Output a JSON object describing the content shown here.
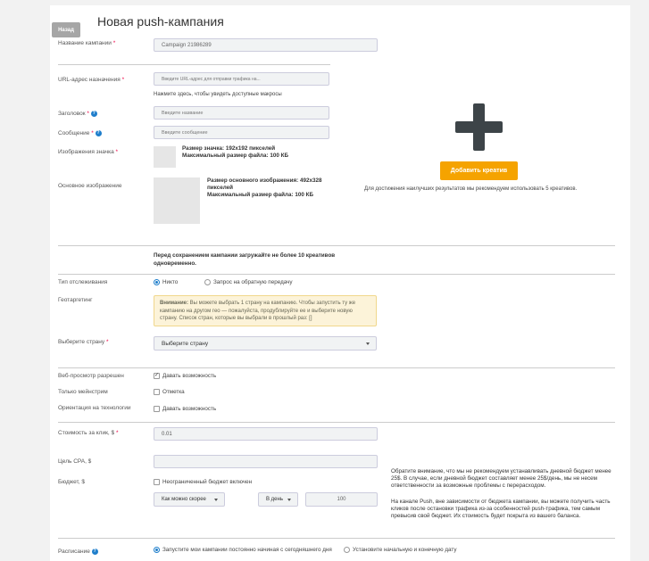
{
  "header": {
    "back_label": "Назад",
    "title": "Новая push-кампания"
  },
  "campaign_name": {
    "label": "Название кампании",
    "required": "*",
    "value": "Campaign 21986289"
  },
  "url": {
    "label": "URL-адрес назначения",
    "required": "*",
    "placeholder": "Введите URL-адрес для отправки трафика на...",
    "macros_hint": "Нажмите здесь, чтобы увидеть доступные макросы"
  },
  "headline": {
    "label": "Заголовок",
    "required": "*",
    "placeholder": "Введите название"
  },
  "message": {
    "label": "Сообщение",
    "required": "*",
    "placeholder": "Введите сообщение"
  },
  "icon_image": {
    "label": "Изображения значка",
    "required": "*",
    "size_text": "Размер значка: 192x192 пикселей",
    "max_size": "Максимальный размер файла: 100 КБ"
  },
  "main_image": {
    "label": "Основное изображение",
    "size_text": "Размер основного изображения: 492x328 пикселей",
    "max_size": "Максимальный размер файла: 100 КБ"
  },
  "creative": {
    "add_label": "Добавить креатив",
    "recommend": "Для достижения наилучших результатов мы рекомендуем использовать 5 креативов."
  },
  "upload_note": "Перед сохранением кампании загружайте не более 10 креативов одновременно.",
  "tracking": {
    "label": "Тип отслеживания",
    "options": [
      "Никто",
      "Запрос на обратную передачу"
    ]
  },
  "geo": {
    "label": "Геотаргетинг",
    "warning_title": "Внимание:",
    "warning_text": "Вы можете выбрать 1 страну на кампанию. Чтобы запустить ту же кампанию на другом гео — пожалуйста, продублируйте ее и выберите новую страну. Список стран, которые вы выбрали в прошлый раз: []"
  },
  "country": {
    "label": "Выберите страну",
    "required": "*",
    "value": "Выберите страну"
  },
  "webview": {
    "label": "Веб-просмотр разрешен",
    "option": "Давать возможность"
  },
  "mainstream": {
    "label": "Только мейнстрим",
    "option": "Отметка"
  },
  "tech": {
    "label": "Ориентация на технологии",
    "option": "Давать возможность"
  },
  "cpc": {
    "label": "Стоимость за клик, $",
    "required": "*",
    "value": "0.01"
  },
  "cpa": {
    "label": "Цель CPA, $"
  },
  "budget": {
    "label": "Бюджет, $",
    "unlimited": "Неограниченный бюджет включен",
    "speed": "Как можно скорее",
    "period": "В день",
    "amount": "100"
  },
  "budget_note1": "Обратите внимание, что мы не рекомендуем устанавливать дневной бюджет менее 25$. В случае, если дневной бюджет составляет менее 25$/день, мы не несем ответственности за возможные проблемы с перерасходом.",
  "budget_note2": "На канале Push, вне зависимости от бюджета кампании, вы можете получить часть кликов после остановки трафика из-за особенностей push-трафика, тем самым превысив свой бюджет. Их стоимость будет покрыта из вашего баланса.",
  "schedule": {
    "label": "Расписание",
    "opt1": "Запустите мои кампании постоянно начиная с сегодняшнего дня",
    "opt2": "Установите начальную и конечную дату"
  }
}
